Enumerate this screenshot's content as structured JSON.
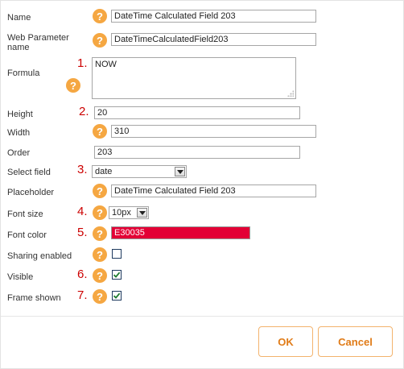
{
  "fields": {
    "name": {
      "label": "Name",
      "value": "DateTime Calculated Field 203"
    },
    "web_parameter_name": {
      "label": "Web Parameter name",
      "value": "DateTimeCalculatedField203"
    },
    "formula": {
      "label": "Formula",
      "value": "NOW",
      "marker": "1."
    },
    "height": {
      "label": "Height",
      "value": "20",
      "marker": "2."
    },
    "width": {
      "label": "Width",
      "value": "310"
    },
    "order": {
      "label": "Order",
      "value": "203"
    },
    "select_field": {
      "label": "Select field",
      "value": "date",
      "marker": "3."
    },
    "placeholder": {
      "label": "Placeholder",
      "value": "DateTime Calculated Field 203"
    },
    "font_size": {
      "label": "Font size",
      "value": "10px",
      "marker": "4."
    },
    "font_color": {
      "label": "Font color",
      "value": "E30035",
      "color": "#e30035",
      "marker": "5."
    },
    "sharing_enabled": {
      "label": "Sharing enabled",
      "checked": false
    },
    "visible": {
      "label": "Visible",
      "checked": true,
      "marker": "6."
    },
    "frame_shown": {
      "label": "Frame shown",
      "checked": true,
      "marker": "7."
    }
  },
  "help_icon": {
    "glyph": "?",
    "name": "help-icon"
  },
  "buttons": {
    "ok": "OK",
    "cancel": "Cancel"
  },
  "colors": {
    "accent": "#f5a742",
    "button_text": "#e07b17",
    "marker": "#cc0000"
  }
}
